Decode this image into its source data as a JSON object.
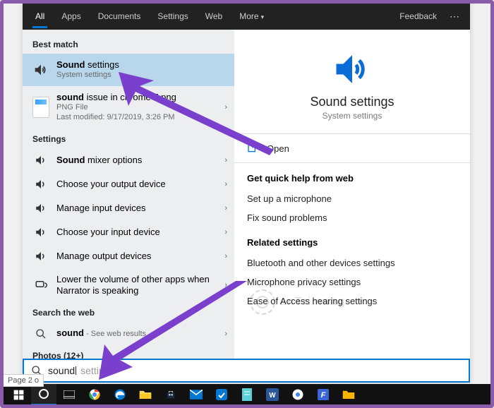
{
  "tabs": {
    "all": "All",
    "apps": "Apps",
    "documents": "Documents",
    "settings": "Settings",
    "web": "Web",
    "more": "More"
  },
  "feedback": "Feedback",
  "left": {
    "best_match": "Best match",
    "result1": {
      "title_bold": "Sound",
      "title_rest": " settings",
      "sub": "System settings"
    },
    "result2": {
      "title_bold": "sound",
      "title_rest": " issue in chrome 7.png",
      "sub1": "PNG File",
      "sub2": "Last modified: 9/17/2019, 3:26 PM"
    },
    "settings_label": "Settings",
    "s1": {
      "bold": "Sound",
      "rest": " mixer options"
    },
    "s2": "Choose your output device",
    "s3": "Manage input devices",
    "s4": "Choose your input device",
    "s5": "Manage output devices",
    "s6": "Lower the volume of other apps when Narrator is speaking",
    "search_web_label": "Search the web",
    "web_item": {
      "bold": "sound",
      "rest": " - See web results"
    },
    "photos_label": "Photos (12+)"
  },
  "right": {
    "title": "Sound settings",
    "sub": "System settings",
    "open": "Open",
    "help_title": "Get quick help from web",
    "help_1": "Set up a microphone",
    "help_2": "Fix sound problems",
    "related_title": "Related settings",
    "rel_1": "Bluetooth and other devices settings",
    "rel_2": "Microphone privacy settings",
    "rel_3": "Ease of Access hearing settings"
  },
  "searchbar": {
    "typed": "sound",
    "ghost": " settings"
  },
  "pagecount": "Page 2 o",
  "watermark": "anTrimang"
}
